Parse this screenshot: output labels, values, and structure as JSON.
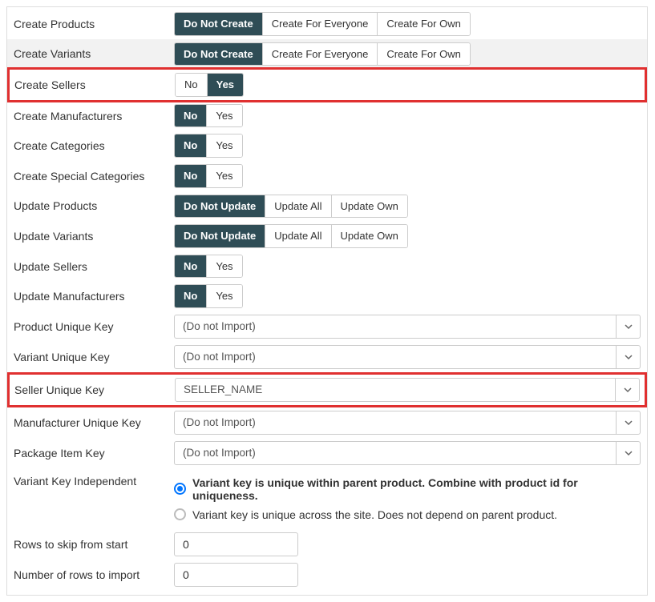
{
  "colors": {
    "accent": "#2f4d56",
    "highlight": "#e03030",
    "radio": "#0075ff"
  },
  "rows": {
    "create_products": {
      "label": "Create Products",
      "options": [
        "Do Not Create",
        "Create For Everyone",
        "Create For Own"
      ],
      "active": 0
    },
    "create_variants": {
      "label": "Create Variants",
      "options": [
        "Do Not Create",
        "Create For Everyone",
        "Create For Own"
      ],
      "active": 0
    },
    "create_sellers": {
      "label": "Create Sellers",
      "options": [
        "No",
        "Yes"
      ],
      "active": 1
    },
    "create_manufacturers": {
      "label": "Create Manufacturers",
      "options": [
        "No",
        "Yes"
      ],
      "active": 0
    },
    "create_categories": {
      "label": "Create Categories",
      "options": [
        "No",
        "Yes"
      ],
      "active": 0
    },
    "create_special_categories": {
      "label": "Create Special Categories",
      "options": [
        "No",
        "Yes"
      ],
      "active": 0
    },
    "update_products": {
      "label": "Update Products",
      "options": [
        "Do Not Update",
        "Update All",
        "Update Own"
      ],
      "active": 0
    },
    "update_variants": {
      "label": "Update Variants",
      "options": [
        "Do Not Update",
        "Update All",
        "Update Own"
      ],
      "active": 0
    },
    "update_sellers": {
      "label": "Update Sellers",
      "options": [
        "No",
        "Yes"
      ],
      "active": 0
    },
    "update_manufacturers": {
      "label": "Update Manufacturers",
      "options": [
        "No",
        "Yes"
      ],
      "active": 0
    },
    "product_key": {
      "label": "Product Unique Key",
      "value": "(Do not Import)"
    },
    "variant_key": {
      "label": "Variant Unique Key",
      "value": "(Do not Import)"
    },
    "seller_key": {
      "label": "Seller Unique Key",
      "value": "SELLER_NAME"
    },
    "manufacturer_key": {
      "label": "Manufacturer Unique Key",
      "value": "(Do not Import)"
    },
    "package_key": {
      "label": "Package Item Key",
      "value": "(Do not Import)"
    },
    "variant_independent": {
      "label": "Variant Key Independent",
      "opt1": "Variant key is unique within parent product. Combine with product id for uniqueness.",
      "opt2": "Variant key is unique across the site. Does not depend on parent product.",
      "selected": 0
    },
    "rows_skip": {
      "label": "Rows to skip from start",
      "value": "0"
    },
    "rows_import": {
      "label": "Number of rows to import",
      "value": "0"
    }
  }
}
